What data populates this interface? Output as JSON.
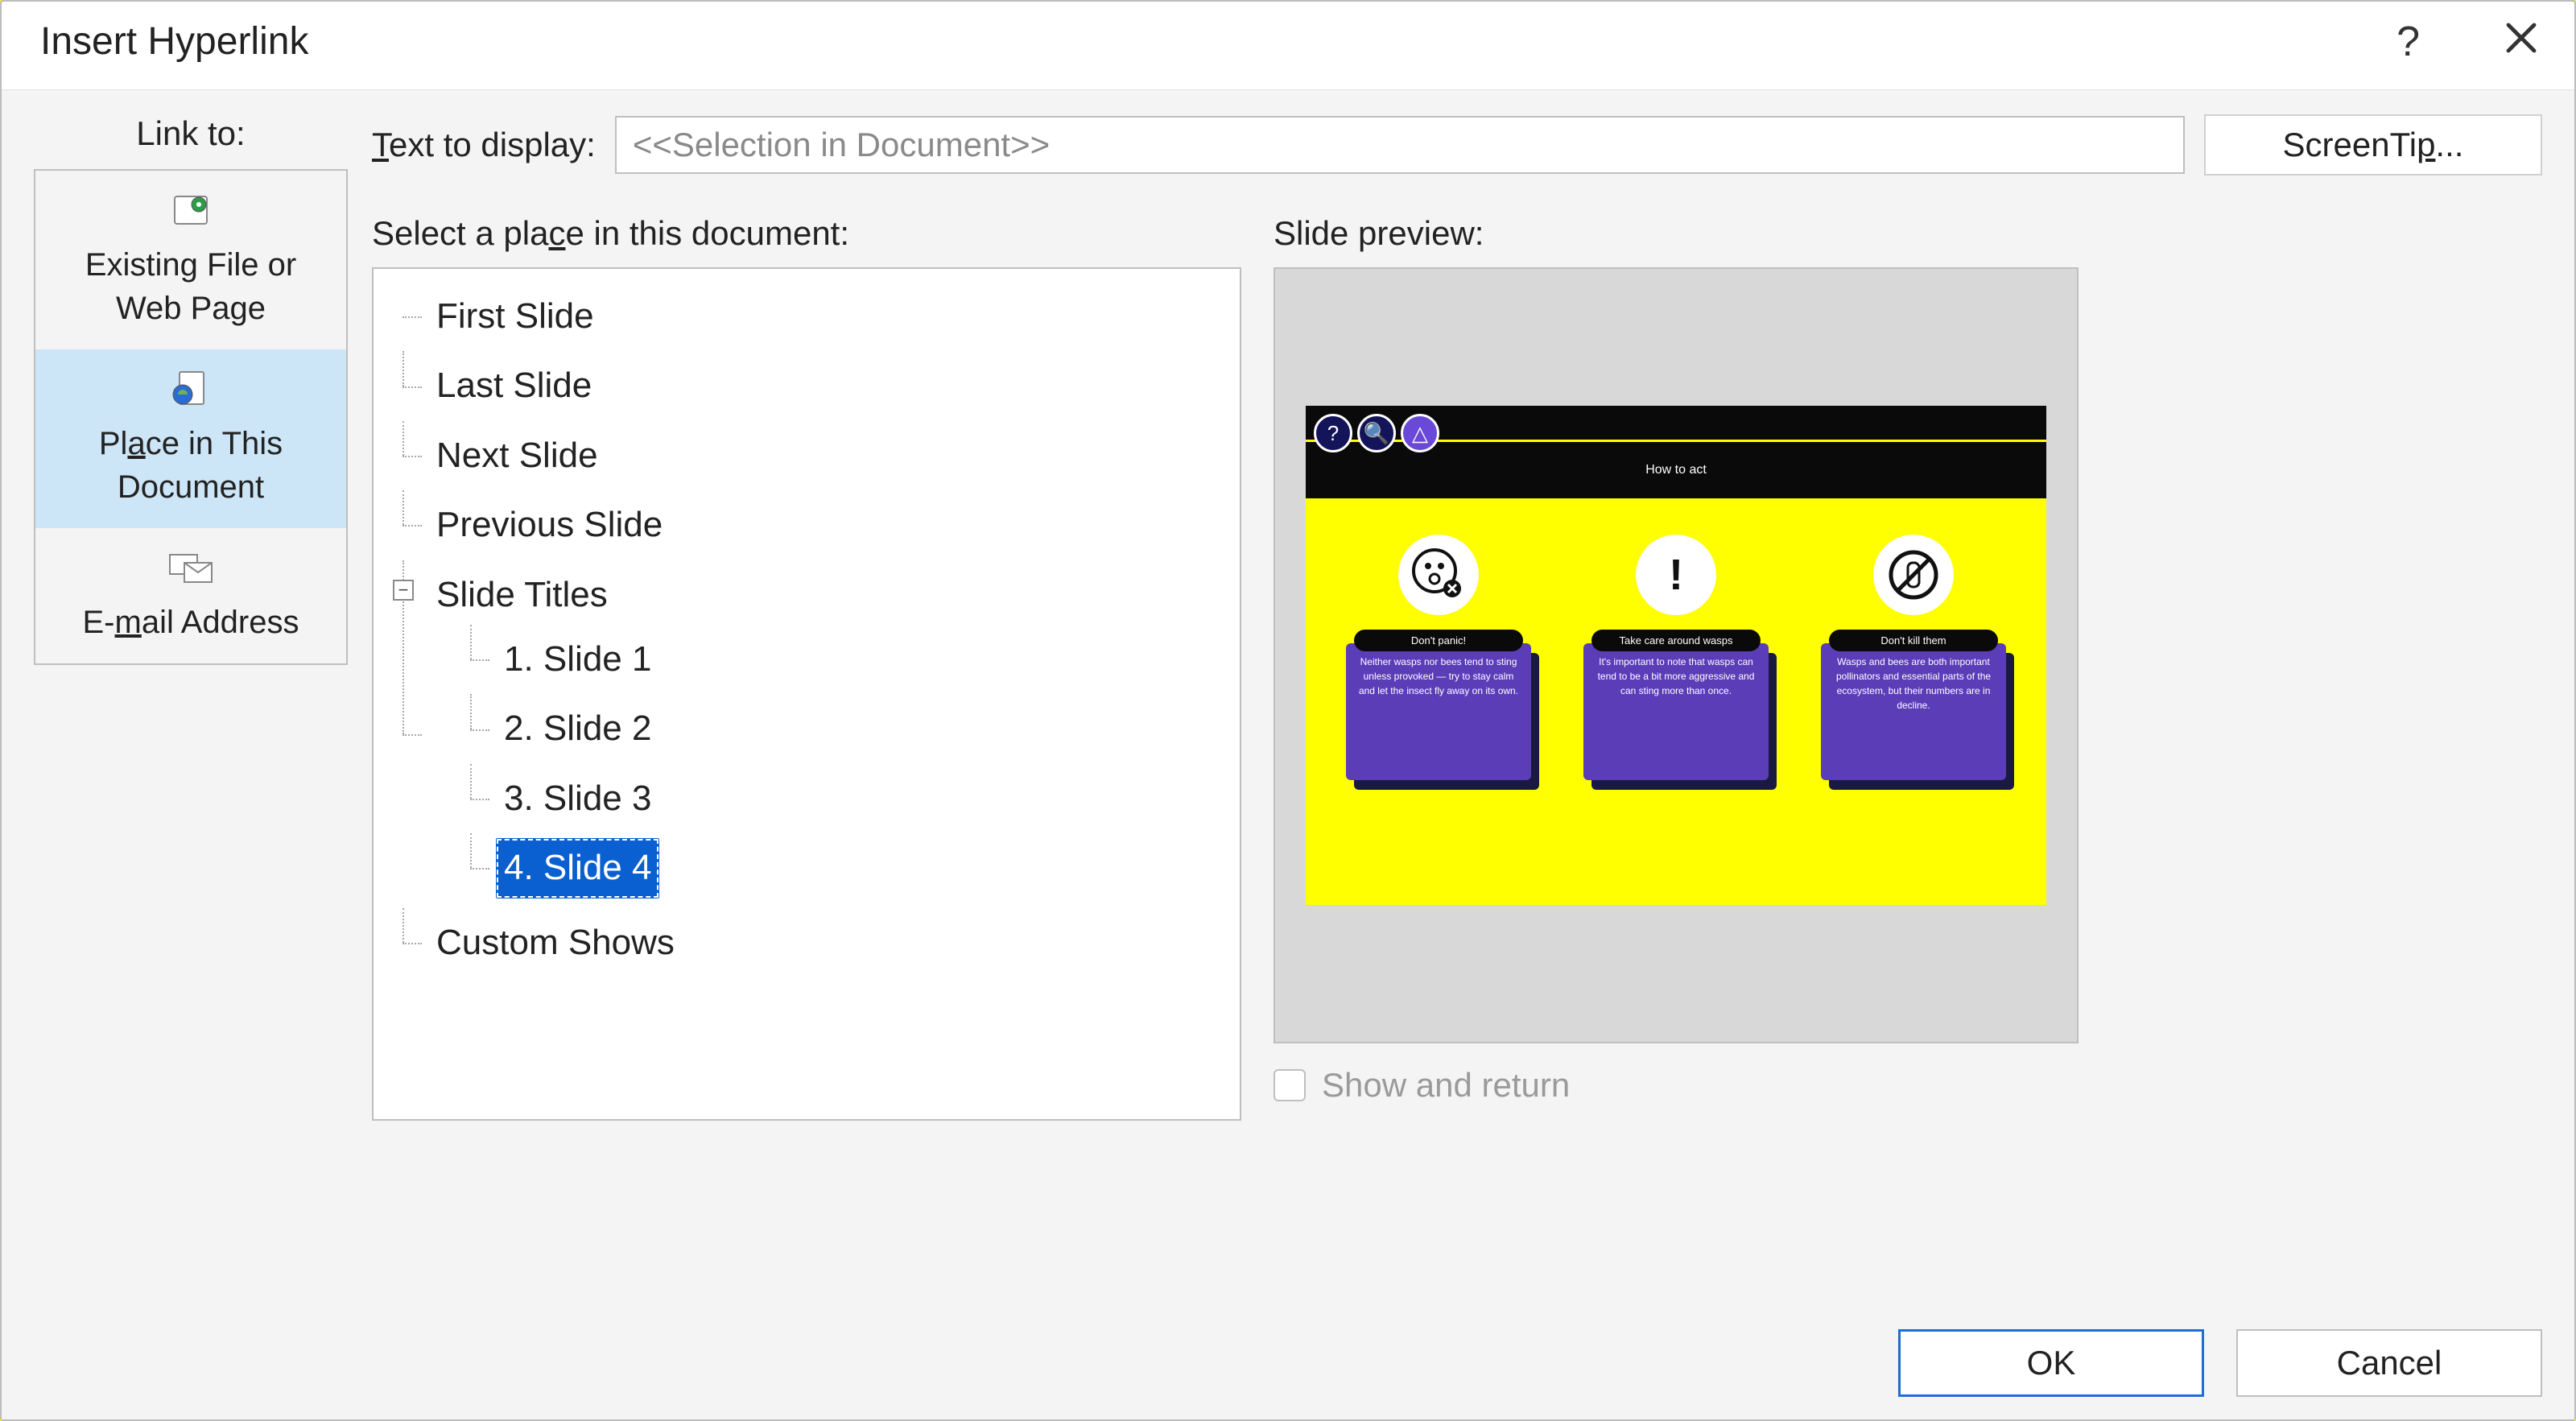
{
  "dialog": {
    "title": "Insert Hyperlink",
    "help_symbol": "?",
    "link_to_label": "Link to:",
    "link_to_items": [
      {
        "id": "existing",
        "line1": "Existing File or",
        "line2": "Web Page"
      },
      {
        "id": "place",
        "line1": "Place in This",
        "line2": "Document"
      },
      {
        "id": "email",
        "line1": "E-mail Address",
        "line2": ""
      }
    ],
    "link_to_selected": "place",
    "text_to_display_label": "Text to display:",
    "text_to_display_value": "<<Selection in Document>>",
    "screentip_label": "ScreenTip...",
    "select_place_label": "Select a place in this document:",
    "tree": {
      "first": "First Slide",
      "last": "Last Slide",
      "next": "Next Slide",
      "previous": "Previous Slide",
      "slide_titles": "Slide Titles",
      "slides": [
        "1. Slide 1",
        "2. Slide 2",
        "3. Slide 3",
        "4. Slide 4"
      ],
      "selected_index": 3,
      "custom_shows": "Custom Shows"
    },
    "slide_preview_label": "Slide preview:",
    "preview_slide": {
      "band_title": "How to act",
      "cards": [
        {
          "pill": "Don't panic!",
          "body": "Neither wasps nor bees tend to sting unless provoked — try to stay calm and let the insect fly away on its own."
        },
        {
          "pill": "Take care around wasps",
          "body": "It's important to note that wasps can tend to be a bit more aggressive and can sting more than once."
        },
        {
          "pill": "Don't kill them",
          "body": "Wasps and bees are both important pollinators and essential parts of the ecosystem, but their numbers are in decline."
        }
      ]
    },
    "show_and_return_label": "Show and return",
    "ok_label": "OK",
    "cancel_label": "Cancel"
  }
}
